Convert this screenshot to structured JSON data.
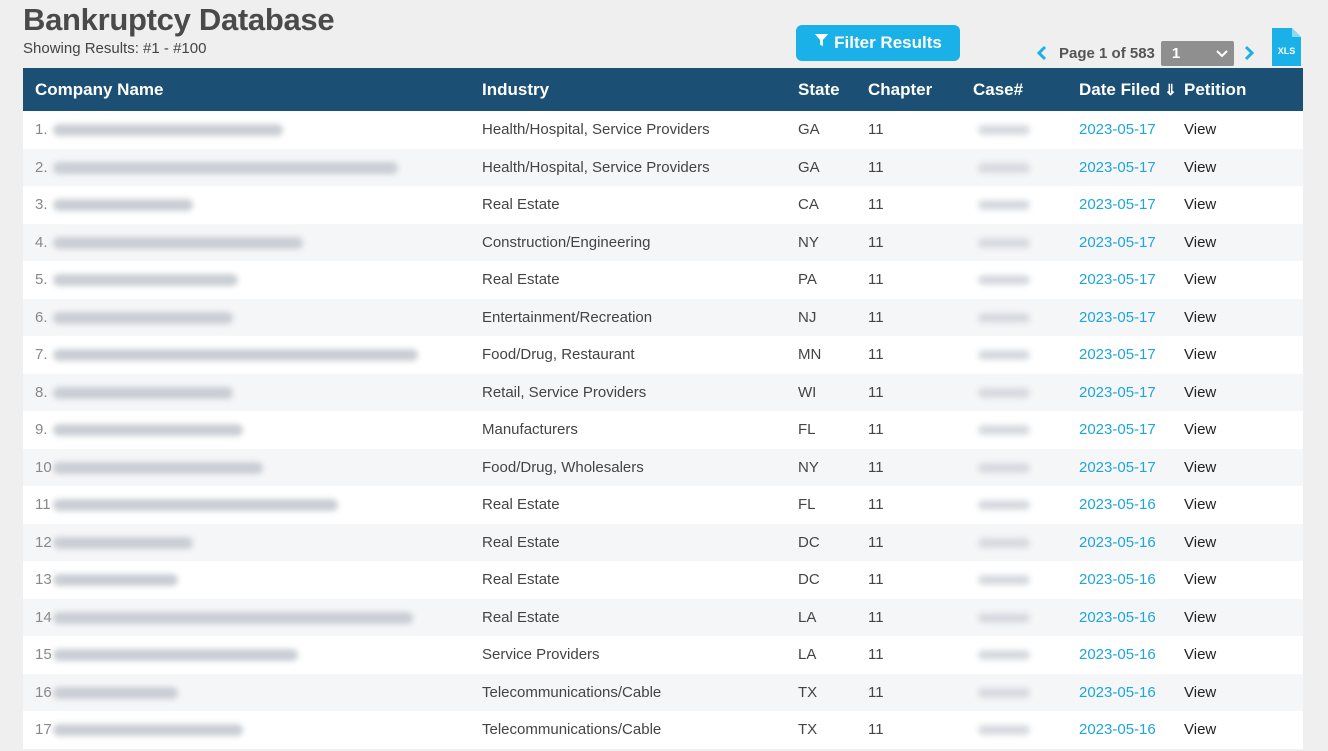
{
  "page": {
    "title": "Bankruptcy Database",
    "subtitle": "Showing Results: #1 - #100"
  },
  "toolbar": {
    "filter_label": "Filter Results",
    "page_text": "Page 1 of 583",
    "page_select_value": "1",
    "xls_label": "XLS"
  },
  "colors": {
    "header_bg": "#1c4f74",
    "accent": "#1ab0e8",
    "link": "#1ea6d9"
  },
  "table": {
    "headers": {
      "company": "Company Name",
      "industry": "Industry",
      "state": "State",
      "chapter": "Chapter",
      "case": "Case#",
      "date": "Date Filed",
      "date_sort_icon": "⇓",
      "petition": "Petition"
    },
    "rows": [
      {
        "num": "1.",
        "industry": "Health/Hospital, Service Providers",
        "state": "GA",
        "chapter": "11",
        "date": "2023-05-17",
        "petition": "View"
      },
      {
        "num": "2.",
        "industry": "Health/Hospital, Service Providers",
        "state": "GA",
        "chapter": "11",
        "date": "2023-05-17",
        "petition": "View"
      },
      {
        "num": "3.",
        "industry": "Real Estate",
        "state": "CA",
        "chapter": "11",
        "date": "2023-05-17",
        "petition": "View"
      },
      {
        "num": "4.",
        "industry": "Construction/Engineering",
        "state": "NY",
        "chapter": "11",
        "date": "2023-05-17",
        "petition": "View"
      },
      {
        "num": "5.",
        "industry": "Real Estate",
        "state": "PA",
        "chapter": "11",
        "date": "2023-05-17",
        "petition": "View"
      },
      {
        "num": "6.",
        "industry": "Entertainment/Recreation",
        "state": "NJ",
        "chapter": "11",
        "date": "2023-05-17",
        "petition": "View"
      },
      {
        "num": "7.",
        "industry": "Food/Drug, Restaurant",
        "state": "MN",
        "chapter": "11",
        "date": "2023-05-17",
        "petition": "View"
      },
      {
        "num": "8.",
        "industry": "Retail, Service Providers",
        "state": "WI",
        "chapter": "11",
        "date": "2023-05-17",
        "petition": "View"
      },
      {
        "num": "9.",
        "industry": "Manufacturers",
        "state": "FL",
        "chapter": "11",
        "date": "2023-05-17",
        "petition": "View"
      },
      {
        "num": "10",
        "industry": "Food/Drug, Wholesalers",
        "state": "NY",
        "chapter": "11",
        "date": "2023-05-17",
        "petition": "View"
      },
      {
        "num": "11",
        "industry": "Real Estate",
        "state": "FL",
        "chapter": "11",
        "date": "2023-05-16",
        "petition": "View"
      },
      {
        "num": "12",
        "industry": "Real Estate",
        "state": "DC",
        "chapter": "11",
        "date": "2023-05-16",
        "petition": "View"
      },
      {
        "num": "13",
        "industry": "Real Estate",
        "state": "DC",
        "chapter": "11",
        "date": "2023-05-16",
        "petition": "View"
      },
      {
        "num": "14",
        "industry": "Real Estate",
        "state": "LA",
        "chapter": "11",
        "date": "2023-05-16",
        "petition": "View"
      },
      {
        "num": "15",
        "industry": "Service Providers",
        "state": "LA",
        "chapter": "11",
        "date": "2023-05-16",
        "petition": "View"
      },
      {
        "num": "16",
        "industry": "Telecommunications/Cable",
        "state": "TX",
        "chapter": "11",
        "date": "2023-05-16",
        "petition": "View"
      },
      {
        "num": "17",
        "industry": "Telecommunications/Cable",
        "state": "TX",
        "chapter": "11",
        "date": "2023-05-16",
        "petition": "View"
      }
    ]
  }
}
